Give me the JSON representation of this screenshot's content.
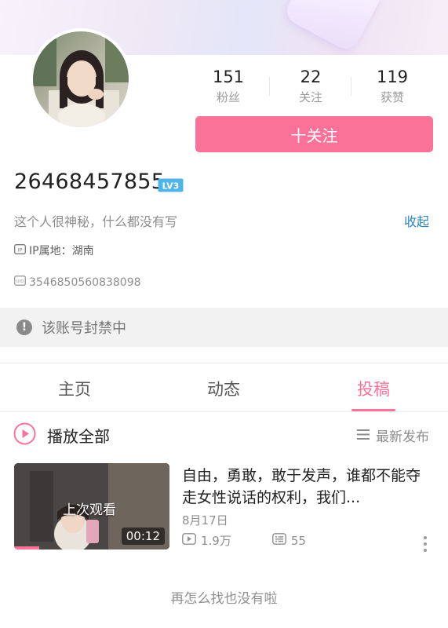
{
  "profile": {
    "username": "26468457855",
    "level": "LV3",
    "signature": "这个人很神秘，什么都没有写",
    "collapse_label": "收起",
    "ip_location": "IP属地：湖南",
    "uid": "3546850560838098",
    "banned_notice": "该账号封禁中"
  },
  "stats": [
    {
      "count": "151",
      "label": "粉丝"
    },
    {
      "count": "22",
      "label": "关注"
    },
    {
      "count": "119",
      "label": "获赞"
    }
  ],
  "follow_button": "十关注",
  "tabs": [
    {
      "label": "主页",
      "active": false
    },
    {
      "label": "动态",
      "active": false
    },
    {
      "label": "投稿",
      "active": true
    }
  ],
  "list_header": {
    "play_all": "播放全部",
    "sort": "最新发布"
  },
  "videos": [
    {
      "title": "自由，勇敢，敢于发声，谁都不能夺走女性说话的权利，我们...",
      "date": "8月17日",
      "views": "1.9万",
      "comments": "55",
      "duration": "00:12",
      "watched_label": "上次观看",
      "watch_progress": 0.16
    }
  ],
  "end_message": "再怎么找也没有啦",
  "colors": {
    "accent": "#fb7299",
    "link": "#2a84c2",
    "level_badge": "#4fb4e8"
  }
}
